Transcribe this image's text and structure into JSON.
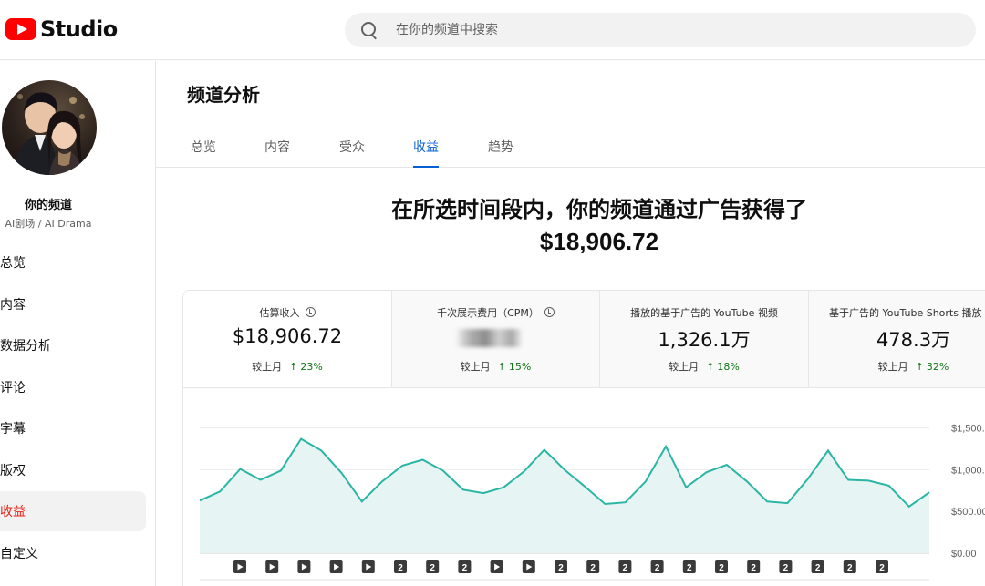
{
  "app": {
    "logo_text": "Studio",
    "brand_color": "#ff0000"
  },
  "search": {
    "placeholder": "在你的频道中搜索"
  },
  "channel": {
    "name": "你的频道",
    "subtitle": "AI剧场 / AI Drama"
  },
  "sidebar": {
    "items": [
      {
        "label": "总览",
        "active": false
      },
      {
        "label": "内容",
        "active": false
      },
      {
        "label": "数据分析",
        "active": false
      },
      {
        "label": "评论",
        "active": false
      },
      {
        "label": "字幕",
        "active": false
      },
      {
        "label": "版权",
        "active": false
      },
      {
        "label": "收益",
        "active": true
      },
      {
        "label": "自定义",
        "active": false
      }
    ]
  },
  "page": {
    "title": "频道分析"
  },
  "tabs": [
    {
      "label": "总览",
      "active": false
    },
    {
      "label": "内容",
      "active": false
    },
    {
      "label": "受众",
      "active": false
    },
    {
      "label": "收益",
      "active": true
    },
    {
      "label": "趋势",
      "active": false
    }
  ],
  "headline": {
    "text": "在所选时间段内，你的频道通过广告获得了",
    "amount": "$18,906.72"
  },
  "metrics": [
    {
      "label": "估算收入",
      "info_icon": true,
      "value": "$18,906.72",
      "compare_label": "较上月",
      "delta": "23%",
      "selected": true
    },
    {
      "label": "千次展示费用（CPM）",
      "info_icon": true,
      "value": "",
      "blurred": true,
      "compare_label": "较上月",
      "delta": "15%",
      "selected": false
    },
    {
      "label": "播放的基于广告的 YouTube 视频",
      "info_icon": false,
      "value": "1,326.1万",
      "compare_label": "较上月",
      "delta": "18%",
      "selected": false
    },
    {
      "label": "基于广告的 YouTube Shorts 播放",
      "info_icon": false,
      "value": "478.3万",
      "compare_label": "较上月",
      "delta": "32%",
      "selected": false
    }
  ],
  "colors": {
    "line": "#2ab5a5",
    "area": "#e6f4f3",
    "delta_up": "#107516",
    "active_tab": "#065fd4",
    "active_nav": "#e62117"
  },
  "chart_data": {
    "type": "area",
    "y_tick_labels": [
      "$1,500.",
      "$1,000.",
      "$500.00",
      "$0.00"
    ],
    "y_ticks": [
      1500,
      1000,
      500,
      0
    ],
    "ylim": [
      0,
      1650
    ],
    "values": [
      630,
      740,
      1010,
      880,
      990,
      1370,
      1230,
      960,
      620,
      860,
      1050,
      1120,
      990,
      760,
      720,
      790,
      980,
      1240,
      1000,
      800,
      590,
      610,
      860,
      1280,
      790,
      970,
      1060,
      860,
      620,
      600,
      890,
      1230,
      880,
      870,
      810,
      560,
      730
    ],
    "markers": [
      "play",
      "play",
      "play",
      "play",
      "play",
      "2",
      "2",
      "2",
      "play",
      "play",
      "2",
      "2",
      "2",
      "2",
      "2",
      "2",
      "2",
      "2",
      "2",
      "2",
      "2"
    ],
    "grid": true,
    "legend": "none"
  }
}
